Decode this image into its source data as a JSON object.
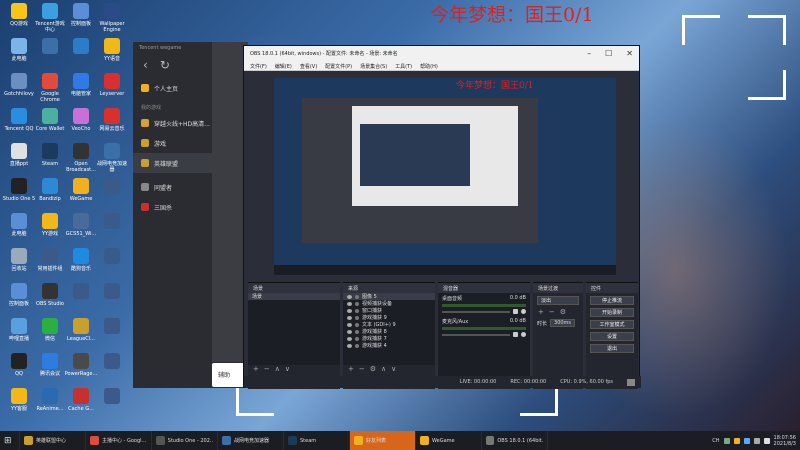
{
  "wallpaper": {
    "title": "今年梦想：国王0/1"
  },
  "desktop_icons": [
    {
      "label": "QQ游戏",
      "color": "#f5c518"
    },
    {
      "label": "Tencent游戏中心",
      "color": "#3aa0e0"
    },
    {
      "label": "控制面板",
      "color": "#5a8fd8"
    },
    {
      "label": "Wallpaper Engine",
      "color": "#2a4a88"
    },
    {
      "label": "此电脑",
      "color": "#7ab4e8"
    },
    {
      "label": "",
      "color": "#3a6fa8"
    },
    {
      "label": "",
      "color": "#2d7cc8"
    },
    {
      "label": "YY语音",
      "color": "#f2b818"
    },
    {
      "label": "Gotchhilovy",
      "color": "#6a8fc0"
    },
    {
      "label": "Google Chrome",
      "color": "#e24b3b"
    },
    {
      "label": "电脑管家",
      "color": "#2f7ae5"
    },
    {
      "label": "Leyserver",
      "color": "#d83030"
    },
    {
      "label": "Tencent QQ",
      "color": "#2b8de0"
    },
    {
      "label": "Core Wallet",
      "color": "#4ab0a0"
    },
    {
      "label": "VeoCho",
      "color": "#c86fd8"
    },
    {
      "label": "网易云音乐",
      "color": "#d82f2f"
    },
    {
      "label": "直播ppt",
      "color": "#e0e0e0"
    },
    {
      "label": "Steam",
      "color": "#1b3a5c"
    },
    {
      "label": "Open Broadcast...",
      "color": "#333"
    },
    {
      "label": "战网电竞加速器",
      "color": "#3a6fa8"
    },
    {
      "label": "Studio One 5",
      "color": "#222"
    },
    {
      "label": "Bandizip",
      "color": "#2e88d8"
    },
    {
      "label": "WeGame",
      "color": "#f0b020"
    },
    {
      "label": "",
      "color": "#3a5a8a"
    },
    {
      "label": "此电脑",
      "color": "#5a8fd8"
    },
    {
      "label": "YY游戏",
      "color": "#f2b818"
    },
    {
      "label": "GCS51_Wi...",
      "color": "#4a6a9a"
    },
    {
      "label": "",
      "color": "#3a5a8a"
    },
    {
      "label": "回收站",
      "color": "#9ab"
    },
    {
      "label": "常用插件组",
      "color": "#3a5a8a"
    },
    {
      "label": "酷狗音乐",
      "color": "#1f8ae0"
    },
    {
      "label": "",
      "color": "#3a5a8a"
    },
    {
      "label": "控制面板",
      "color": "#5a8fd8"
    },
    {
      "label": "OBS Studio",
      "color": "#333"
    },
    {
      "label": "",
      "color": "#3a5a8a"
    },
    {
      "label": "",
      "color": "#3a5a8a"
    },
    {
      "label": "哔哩直播",
      "color": "#5aa0e0"
    },
    {
      "label": "微信",
      "color": "#2ab040"
    },
    {
      "label": "LeagueCl...",
      "color": "#c8a030"
    },
    {
      "label": "",
      "color": "#3a5a8a"
    },
    {
      "label": "QQ",
      "color": "#222"
    },
    {
      "label": "腾讯会议",
      "color": "#2b7de0"
    },
    {
      "label": "PowerRage...",
      "color": "#4a4a4a"
    },
    {
      "label": "",
      "color": "#3a5a8a"
    },
    {
      "label": "YY客服",
      "color": "#f2b818"
    },
    {
      "label": "ReAnime...",
      "color": "#2a6ab0"
    },
    {
      "label": "Cache G...",
      "color": "#c83030"
    },
    {
      "label": "",
      "color": "#3a5a8a"
    }
  ],
  "wegame": {
    "brand": "Tencent wegame",
    "back_icon": "chevron-left-icon",
    "refresh_icon": "refresh-icon",
    "user_label": "个人主页",
    "section": "我的游戏",
    "items": [
      {
        "label": "穿越火线+HD高清...",
        "color": "#d8a030",
        "selected": false
      },
      {
        "label": "游戏",
        "color": "#c8a030",
        "selected": false
      },
      {
        "label": "英雄联盟",
        "color": "#c8a030",
        "selected": true
      },
      {
        "label": "同盟者",
        "color": "#888",
        "selected": false
      },
      {
        "label": "三国杀",
        "color": "#c83030",
        "selected": false
      }
    ],
    "search_placeholder": "辅助"
  },
  "obs": {
    "title": "OBS 18.0.1 (64bit, windows) - 配置文件: 未命名 - 场景: 未命名",
    "menu": [
      "文件(F)",
      "编辑(E)",
      "查看(V)",
      "配置文件(P)",
      "场景集合(S)",
      "工具(T)",
      "帮助(H)"
    ],
    "preview_overlay": "今年梦想：国王0/1",
    "docks": {
      "scenes_header": "场景",
      "scene_items": [
        "场景"
      ],
      "sources_header": "来源",
      "source_items": [
        "图像 5",
        "视频捕获设备",
        "窗口捕获",
        "游戏捕获 9",
        "文本 (GDI+) 9",
        "游戏捕获 8",
        "游戏捕获 7",
        "游戏捕获 4"
      ],
      "mixer_header": "混音器",
      "mixer_items": [
        {
          "name": "桌面音频",
          "value": "0.0 dB"
        },
        {
          "name": "麦克风/Aux",
          "value": "0.0 dB"
        }
      ],
      "transitions_header": "场景过渡",
      "transition_select": "淡出",
      "duration_label": "时长",
      "duration_value": "300ms",
      "controls_header": "控件",
      "control_buttons": [
        "停止推流",
        "开始录制",
        "工作室模式",
        "设置",
        "退出"
      ]
    },
    "status": {
      "live": "LIVE: 00:00:00",
      "rec": "REC: 00:00:00",
      "cpu": "CPU: 0.9%, 60.00 fps"
    }
  },
  "taskbar": {
    "items": [
      {
        "label": "英雄联盟中心",
        "color": "#c8a030",
        "active": false
      },
      {
        "label": "主播中心 - Googl...",
        "color": "#e24b3b",
        "active": false
      },
      {
        "label": "Studio One - 202...",
        "color": "#555",
        "active": false
      },
      {
        "label": "战网电竞加速器",
        "color": "#3a6fa8",
        "active": false
      },
      {
        "label": "Steam",
        "color": "#1b3a5c",
        "active": false
      },
      {
        "label": "好友列表",
        "color": "#f0b020",
        "active": true
      },
      {
        "label": "WeGame",
        "color": "#f0b020",
        "active": false
      },
      {
        "label": "OBS 18.0.1 (64bit...",
        "color": "#777",
        "active": false
      }
    ],
    "tray_text": "CH",
    "time": "18:07:56",
    "date": "2021/8/3"
  }
}
